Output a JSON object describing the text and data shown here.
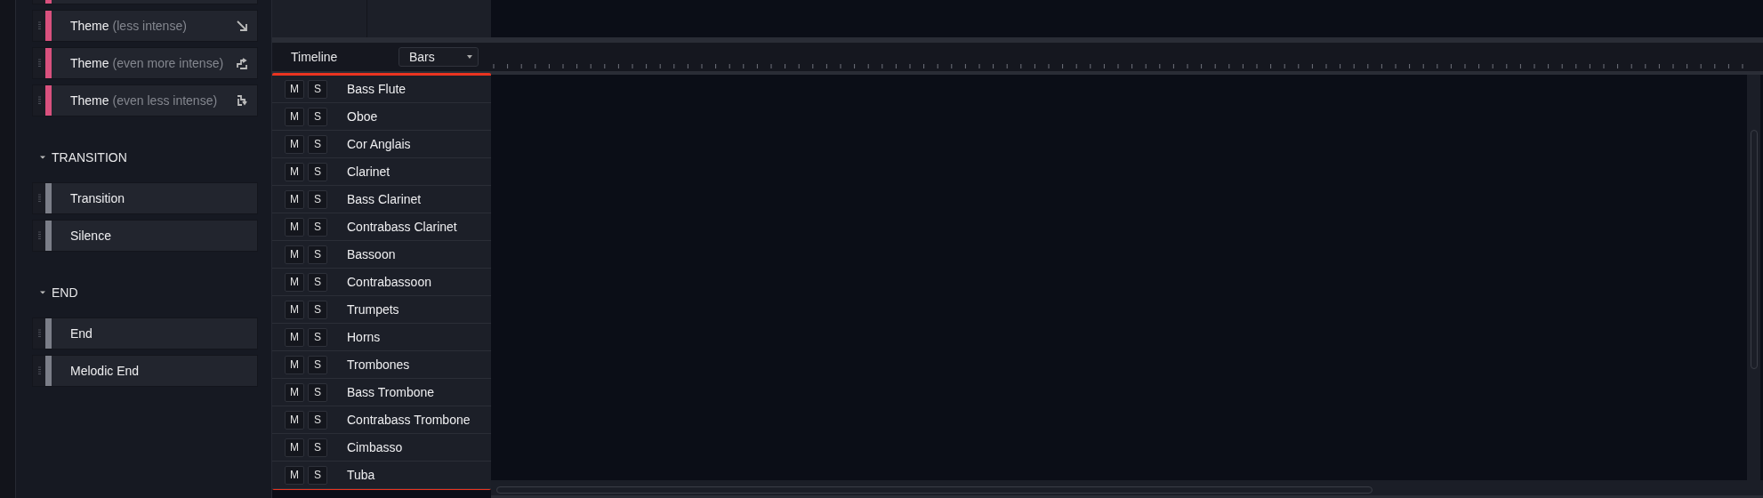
{
  "palette": {
    "sections": [
      {
        "cards": [
          {
            "color": "#d9517e"
          },
          {
            "name": "Theme",
            "note": "(less intense)",
            "color": "#d9517e",
            "kind": "descend"
          },
          {
            "name": "Theme",
            "note": "(even more intense)",
            "color": "#d9517e",
            "kind": "rise"
          },
          {
            "name": "Theme",
            "note": "(even less intense)",
            "color": "#d9517e",
            "kind": "fall"
          }
        ]
      },
      {
        "heading": "TRANSITION",
        "expanded": true,
        "cards": [
          {
            "name": "Transition",
            "color": "#7b7e88"
          },
          {
            "name": "Silence",
            "color": "#7b7e88"
          }
        ]
      },
      {
        "heading": "END",
        "expanded": true,
        "cards": [
          {
            "name": "End",
            "color": "#7b7e88"
          },
          {
            "name": "Melodic End",
            "color": "#7b7e88"
          }
        ]
      }
    ]
  },
  "timeline": {
    "label": "Timeline",
    "mode": "Bars"
  },
  "tracks": [
    {
      "mute": "M",
      "solo": "S",
      "name": "Bass Flute",
      "muted": false,
      "soloed": false
    },
    {
      "mute": "M",
      "solo": "S",
      "name": "Oboe",
      "muted": false,
      "soloed": false
    },
    {
      "mute": "M",
      "solo": "S",
      "name": "Cor Anglais",
      "muted": false,
      "soloed": false
    },
    {
      "mute": "M",
      "solo": "S",
      "name": "Clarinet",
      "muted": false,
      "soloed": false
    },
    {
      "mute": "M",
      "solo": "S",
      "name": "Bass Clarinet",
      "muted": false,
      "soloed": false
    },
    {
      "mute": "M",
      "solo": "S",
      "name": "Contrabass Clarinet",
      "muted": false,
      "soloed": false
    },
    {
      "mute": "M",
      "solo": "S",
      "name": "Bassoon",
      "muted": false,
      "soloed": false
    },
    {
      "mute": "M",
      "solo": "S",
      "name": "Contrabassoon",
      "muted": false,
      "soloed": false
    },
    {
      "mute": "M",
      "solo": "S",
      "name": "Trumpets",
      "muted": false,
      "soloed": false
    },
    {
      "mute": "M",
      "solo": "S",
      "name": "Horns",
      "muted": false,
      "soloed": false
    },
    {
      "mute": "M",
      "solo": "S",
      "name": "Trombones",
      "muted": false,
      "soloed": false
    },
    {
      "mute": "M",
      "solo": "S",
      "name": "Bass Trombone",
      "muted": false,
      "soloed": false
    },
    {
      "mute": "M",
      "solo": "S",
      "name": "Contrabass Trombone",
      "muted": false,
      "soloed": false
    },
    {
      "mute": "M",
      "solo": "S",
      "name": "Cimbasso",
      "muted": false,
      "soloed": false
    },
    {
      "mute": "M",
      "solo": "S",
      "name": "Tuba",
      "muted": false,
      "soloed": false
    }
  ]
}
